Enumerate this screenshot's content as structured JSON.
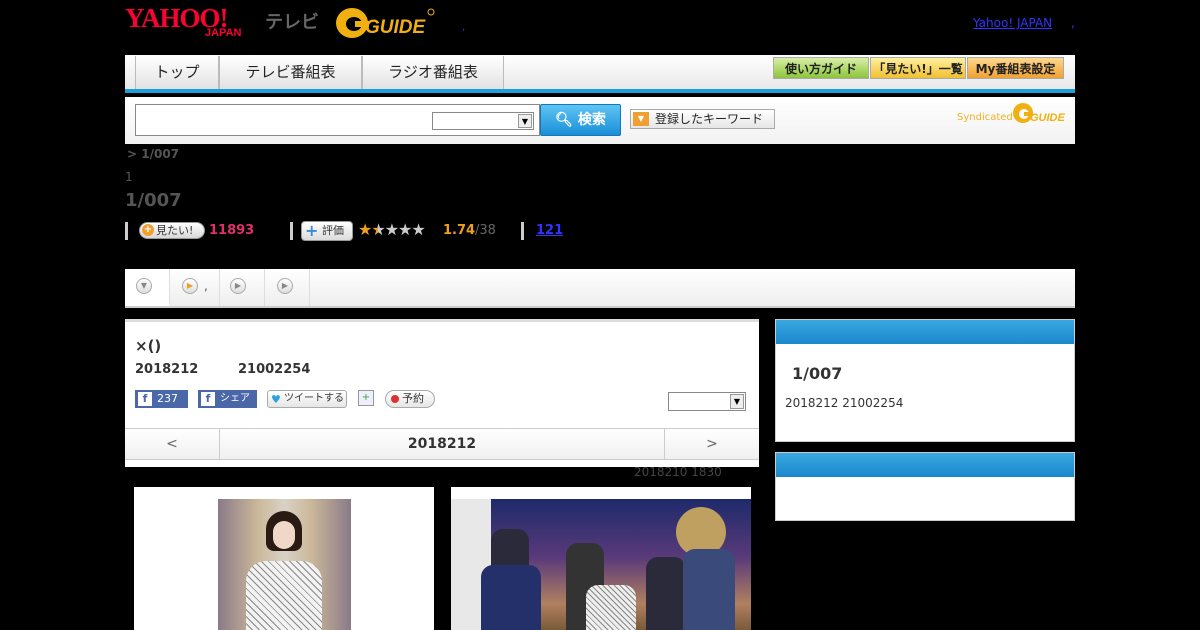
{
  "header": {
    "yahoo_logo": "YAHOO!",
    "japan_logo": "JAPAN",
    "tv_label": "テレビ",
    "gguide_logo": "G-GUIDE",
    "small_link": ",",
    "yahoo_japan_link": "Yahoo! JAPAN",
    "trailing_link": ","
  },
  "nav": {
    "tabs": [
      "トップ",
      "テレビ番組表",
      "ラジオ番組表"
    ],
    "buttons": [
      "使い方ガイド",
      "「見たい!」一覧",
      "My番組表設定"
    ],
    "button_colors": [
      "#8cc43a",
      "#f0c030",
      "#f0a030"
    ]
  },
  "search": {
    "input_value": "",
    "select_value": "",
    "button_label": "検索",
    "keyword_button": "登録したキーワード",
    "syndicated_label": "Syndicated",
    "syndicated_logo": "G-GUIDE"
  },
  "program": {
    "breadcrumb": "> 1/007",
    "episode": "1",
    "title": "1/007",
    "mitai_label": "見たい!",
    "mitai_count": "11893",
    "hyoka_label": "評価",
    "rating": "1.74",
    "rating_count": "/38",
    "review_count": "121",
    "stars_filled": 1.74,
    "stars_total": 5
  },
  "tabs": {
    "items": [
      "",
      ",",
      "",
      ""
    ]
  },
  "main": {
    "title": "×()",
    "date": "2018212",
    "time": "21002254",
    "fb_like_count": "237",
    "fb_share": "シェア",
    "tweet": "ツイートする",
    "yoyaku": "予約",
    "select_value": "",
    "prev": "<",
    "current_date": "2018212",
    "next": ">",
    "updated": "2018210  1830"
  },
  "sidebar": {
    "box1_title": "1/007",
    "box1_date": "2018212  21002254"
  }
}
